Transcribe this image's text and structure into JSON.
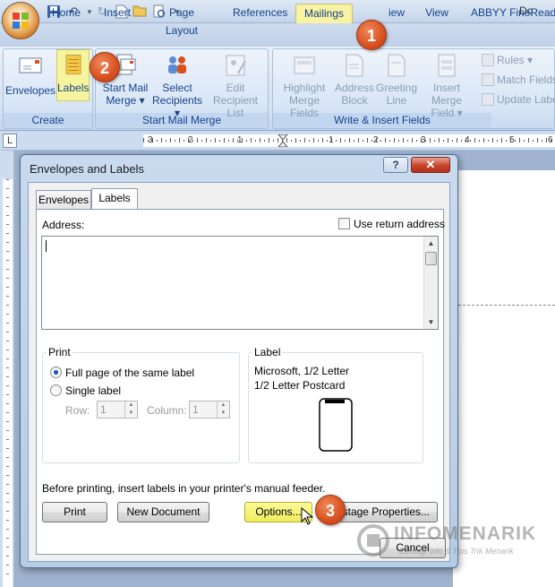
{
  "titlebar": {
    "doc_title": "Do"
  },
  "ribbon_tabs": [
    "Home",
    "Insert",
    "Page Layout",
    "References",
    "Mailings",
    "View",
    "ABBYY FineReader"
  ],
  "ribbon": {
    "create": {
      "label": "Create",
      "envelopes": "Envelopes",
      "labels": "Labels"
    },
    "start_mail_merge": {
      "label": "Start Mail Merge",
      "start_1": "Start Mail",
      "start_2": "Merge ▾",
      "select_1": "Select",
      "select_2": "Recipients ▾",
      "edit_1": "Edit",
      "edit_2": "Recipient List"
    },
    "write_insert": {
      "label": "Write & Insert Fields",
      "highlight_1": "Highlight",
      "highlight_2": "Merge Fields",
      "address_1": "Address",
      "address_2": "Block",
      "greeting_1": "Greeting",
      "greeting_2": "Line",
      "insert_1": "Insert Merge",
      "insert_2": "Field ▾",
      "rules": "Rules ▾",
      "match": "Match Fields",
      "update": "Update Label"
    }
  },
  "ruler": {
    "corner": "L",
    "numbers": [
      "3",
      "2",
      "1",
      "1",
      "2",
      "3",
      "4",
      "5",
      "6"
    ]
  },
  "dialog": {
    "title": "Envelopes and Labels",
    "help": "?",
    "close": "✕",
    "tabs": [
      "Envelopes",
      "Labels"
    ],
    "address_label": "Address:",
    "use_return": "Use return address",
    "print_legend": "Print",
    "full_page": "Full page of the same label",
    "single_label": "Single label",
    "row_label": "Row:",
    "row_value": "1",
    "column_label": "Column:",
    "column_value": "1",
    "label_legend": "Label",
    "label_line1": "Microsoft, 1/2 Letter",
    "label_line2": "1/2 Letter Postcard",
    "note": "Before printing, insert labels in your printer's manual feeder.",
    "print_btn": "Print",
    "new_doc_btn": "New Document",
    "options_btn": "Options...",
    "e_postage_btn": "stage Properties...",
    "cancel_btn": "Cancel"
  },
  "markers": [
    "1",
    "2",
    "3"
  ],
  "watermark": {
    "line1": "INFOMENARIK",
    "line2": "Berbagi Info & Tips Trik Menarik"
  },
  "colors": {
    "highlight": "#f6f59d",
    "marker": "#d9501f",
    "ribbon_text": "#15428b"
  }
}
